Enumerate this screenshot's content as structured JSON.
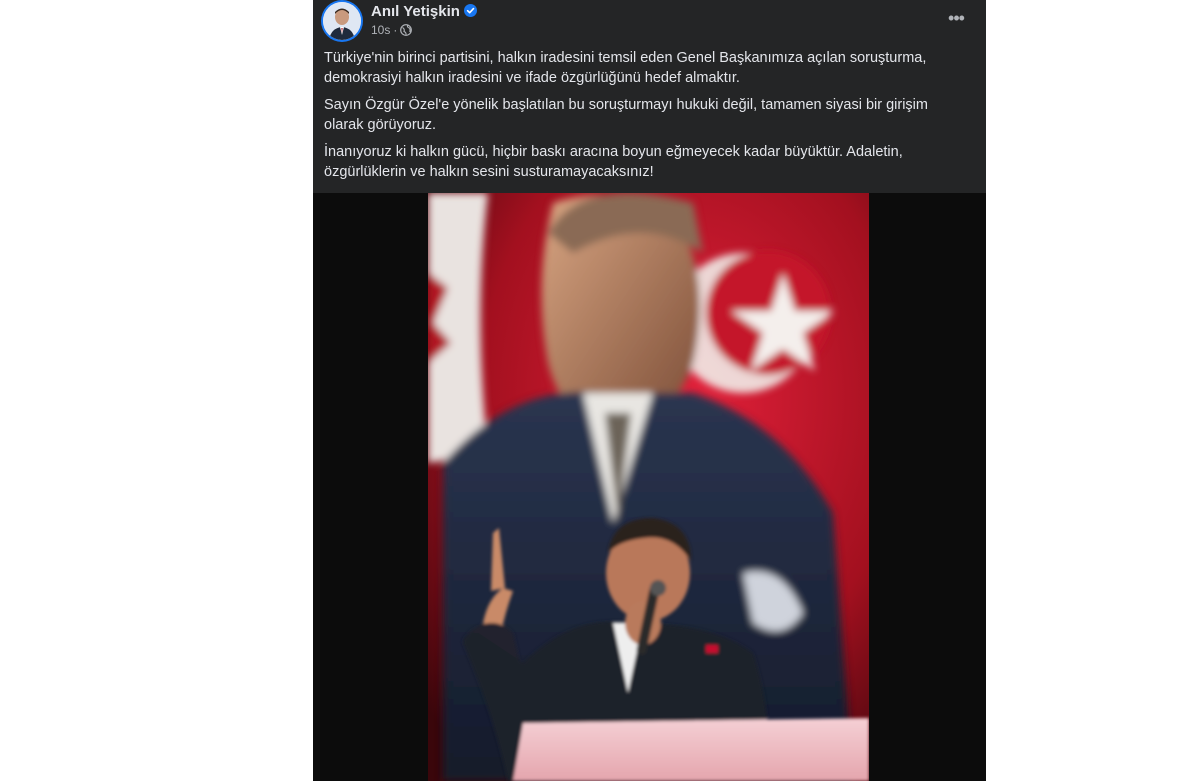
{
  "post": {
    "author": "Anıl Yetişkin",
    "verified": true,
    "time": "10s",
    "separator": "·",
    "visibility_icon": "globe-icon",
    "more_icon": "more-options-icon",
    "more_label": "•••",
    "paragraphs": [
      "Türkiye'nin birinci partisini, halkın iradesini temsil eden Genel Başkanımıza açılan soruşturma, demokrasiyi halkın iradesini ve ifade özgürlüğünü hedef almaktır.",
      "Sayın Özgür Özel'e yönelik başlatılan bu soruşturmayı hukuki değil, tamamen siyasi bir girişim olarak görüyoruz.",
      "İnanıyoruz ki halkın gücü, hiçbir baskı aracına boyun eğmeyecek kadar büyüktür. Adaletin, özgürlüklerin ve halkın sesini susturamayacaksınız!"
    ]
  },
  "colors": {
    "card_bg": "#242526",
    "text": "#e4e6eb",
    "secondary_text": "#b0b3b8",
    "verified_blue": "#1877f2",
    "flag_red": "#c8102e"
  }
}
